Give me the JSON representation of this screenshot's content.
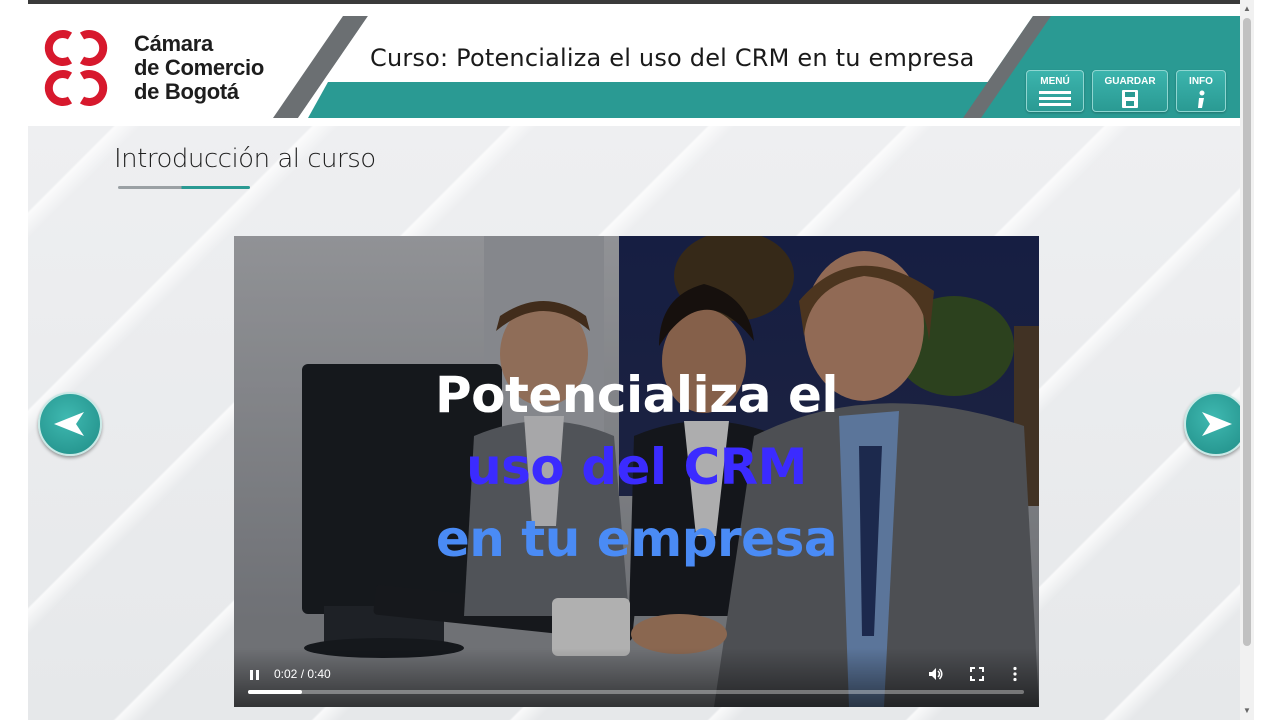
{
  "header": {
    "logo": {
      "line1": "Cámara",
      "line2": "de Comercio",
      "line3": "de Bogotá"
    },
    "course_title": "Curso: Potencializa el uso del CRM en tu empresa",
    "buttons": {
      "menu": "MENÚ",
      "save": "GUARDAR",
      "info": "INFO"
    }
  },
  "main": {
    "section_title": "Introducción al curso"
  },
  "video": {
    "overlay_line1": "Potencializa el",
    "overlay_line2": "uso del CRM",
    "overlay_line3": "en tu empresa",
    "time": "0:02 / 0:40",
    "progress_fraction": 0.07
  },
  "icons": {
    "menu": "hamburger-icon",
    "save": "floppy-disk-icon",
    "info": "info-icon",
    "prev": "arrow-left-icon",
    "next": "arrow-right-icon",
    "pause": "pause-icon",
    "volume": "volume-icon",
    "fullscreen": "fullscreen-icon",
    "more": "more-vertical-icon"
  },
  "colors": {
    "brand_red": "#d7192d",
    "teal": "#2a9a93",
    "overlay_white": "#ffffff",
    "overlay_blue": "#3b2bff",
    "overlay_lightblue": "#4a8bf5"
  }
}
